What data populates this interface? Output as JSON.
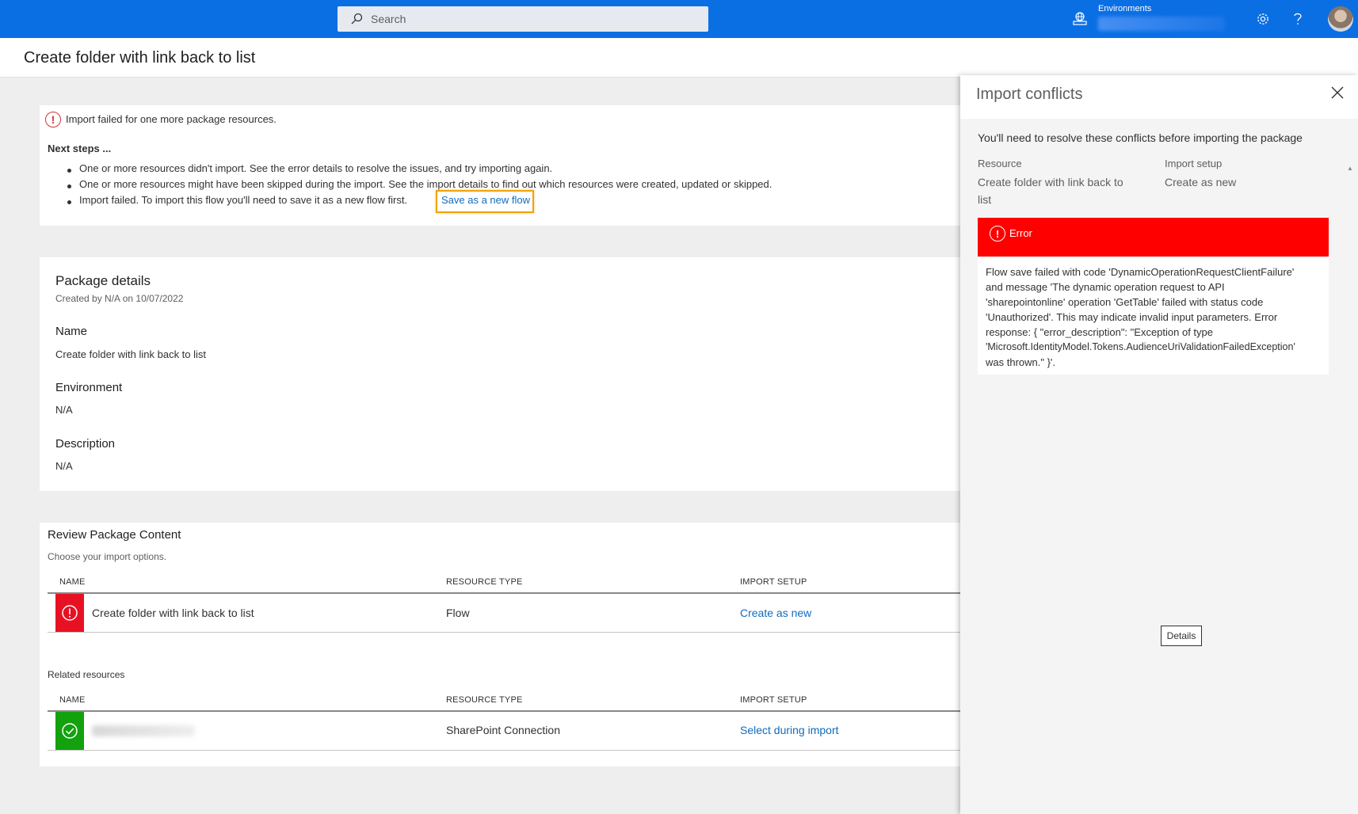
{
  "header": {
    "search_placeholder": "Search",
    "environments_label": "Environments",
    "accent": "#0b6fe4"
  },
  "page": {
    "title": "Create folder with link back to list"
  },
  "notice": {
    "message": "Import failed for one more package resources.",
    "next_steps_title": "Next steps ...",
    "steps": [
      "One or more resources didn't import. See the error details to resolve the issues, and try importing again.",
      "One or more resources might have been skipped during the import. See the import details to find out which resources were created, updated or skipped.",
      "Import failed. To import this flow you'll need to save it as a new flow first."
    ],
    "save_link": "Save as a new flow"
  },
  "package_details": {
    "title": "Package details",
    "created": "Created by N/A on 10/07/2022",
    "name_label": "Name",
    "name_value": "Create folder with link back to list",
    "environment_label": "Environment",
    "environment_value": "N/A",
    "description_label": "Description",
    "description_value": "N/A"
  },
  "review": {
    "title": "Review Package Content",
    "subtitle": "Choose your import options.",
    "columns": [
      "NAME",
      "RESOURCE TYPE",
      "IMPORT SETUP"
    ],
    "rows": [
      {
        "name": "Create folder with link back to list",
        "type": "Flow",
        "setup": "Create as new",
        "status": "error"
      }
    ],
    "related_title": "Related resources",
    "related_rows": [
      {
        "name": "",
        "type": "SharePoint Connection",
        "setup": "Select during import",
        "status": "ok"
      }
    ]
  },
  "panel": {
    "title": "Import conflicts",
    "intro": "You'll need to resolve these conflicts before importing the package",
    "resource_label": "Resource",
    "resource_value_line1": "Create folder with link back to",
    "resource_value_line2": "list",
    "setup_label": "Import setup",
    "setup_value": "Create as new",
    "error_label": "Error",
    "error_lines": [
      "Flow save failed with code 'DynamicOperationRequestClientFailure'",
      "and message 'The dynamic operation request to API",
      "'sharepointonline' operation 'GetTable' failed with status code",
      "'Unauthorized'. This may indicate invalid input parameters. Error",
      "response: { \"error_description\": \"Exception of type",
      "'Microsoft.IdentityModel.Tokens.AudienceUriValidationFailedException'",
      "was thrown.\" }'."
    ],
    "details_button": "Details",
    "error_color": "#ff0000"
  }
}
